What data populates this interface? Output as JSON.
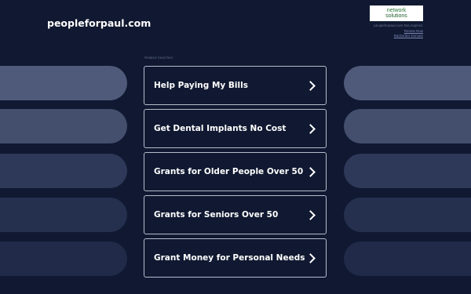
{
  "header": {
    "site_name": "peopleforpaul.com",
    "brand_line1": "network",
    "brand_line2": "solutions",
    "expiry_text": "peopleforpaul.com has expired.",
    "renew_link": "Renew Now",
    "backorder_link": "Backorder Domain"
  },
  "related": {
    "label": "Related Searches:",
    "links": [
      {
        "text": "Help Paying My Bills"
      },
      {
        "text": "Get Dental Implants No Cost"
      },
      {
        "text": "Grants for Older People Over 50"
      },
      {
        "text": "Grants for Seniors Over 50"
      },
      {
        "text": "Grant Money for Personal Needs"
      }
    ]
  },
  "colors": {
    "background": "#101931",
    "link_border": "#b6bccb",
    "text": "#ffffff"
  },
  "icons": {
    "chevron": "chevron-right-icon"
  }
}
